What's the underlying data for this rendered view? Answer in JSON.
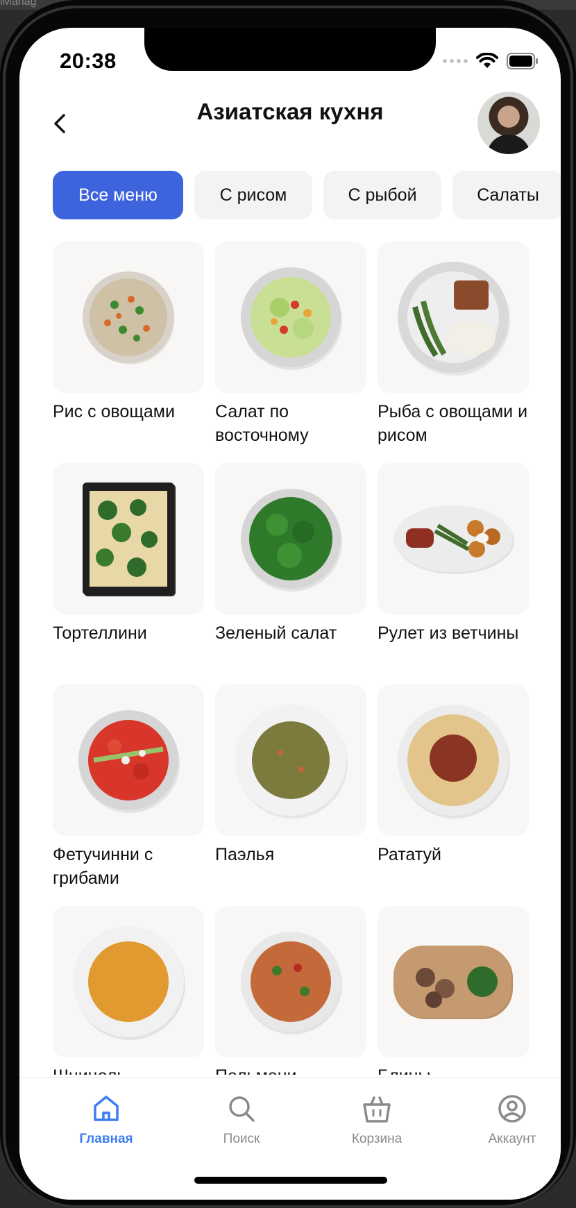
{
  "status_bar": {
    "time": "20:38"
  },
  "desktop": {
    "partial_title": "iManag"
  },
  "header": {
    "title": "Азиатская кухня"
  },
  "chips": [
    {
      "label": "Все меню",
      "active": true
    },
    {
      "label": "С рисом",
      "active": false
    },
    {
      "label": "С рыбой",
      "active": false
    },
    {
      "label": "Салаты",
      "active": false
    }
  ],
  "dishes": [
    {
      "title": "Рис с овощами",
      "icon": "rice-vegetables-bowl"
    },
    {
      "title": "Салат по восточному",
      "icon": "salad-bowl"
    },
    {
      "title": "Рыба с овощами и рисом",
      "icon": "fish-plate"
    },
    {
      "title": "Тортеллини",
      "icon": "tortellini-tray"
    },
    {
      "title": "Зеленый салат",
      "icon": "green-salad-bowl"
    },
    {
      "title": "Рулет из ветчины",
      "icon": "ham-roll-plate"
    },
    {
      "title": "Фетучинни с грибами",
      "icon": "fettuccine-plate"
    },
    {
      "title": "Паэлья",
      "icon": "soup-plate"
    },
    {
      "title": "Рататуй",
      "icon": "spaghetti-plate"
    },
    {
      "title": "Шницель",
      "icon": "cream-soup-plate"
    },
    {
      "title": "Пельмени",
      "icon": "pasta-plate"
    },
    {
      "title": "Блины",
      "icon": "meat-board"
    }
  ],
  "tabbar": [
    {
      "label": "Главная",
      "icon": "home-icon",
      "active": true
    },
    {
      "label": "Поиск",
      "icon": "search-icon",
      "active": false
    },
    {
      "label": "Корзина",
      "icon": "basket-icon",
      "active": false
    },
    {
      "label": "Аккаунт",
      "icon": "account-icon",
      "active": false
    }
  ],
  "colors": {
    "accent": "#3D63DD",
    "tab_active": "#3D7DF2",
    "card_bg": "#F8F7F5",
    "chip_bg": "#F4F3F2"
  }
}
